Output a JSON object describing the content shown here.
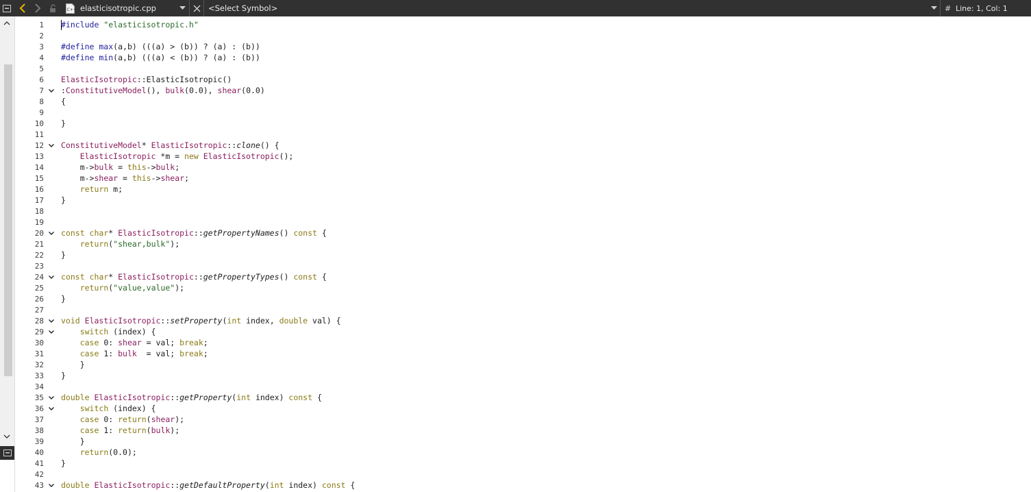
{
  "navbar": {
    "filename": "elasticisotropic.cpp",
    "symbol": "<Select Symbol>",
    "hash": "#",
    "linecol": "Line: 1, Col: 1",
    "icons": [
      "menu-icon",
      "back-icon",
      "forward-icon",
      "lock-icon",
      "cpp-file-icon",
      "chevron-down-icon",
      "close-icon",
      "chevron-down-icon"
    ]
  },
  "colors": {
    "bar_bg": "#313131",
    "back_arrow": "#e6b800",
    "preprocessor": "#1d1d9c",
    "string": "#2a6a2a",
    "class": "#8a1f5e",
    "keyword": "#8a7a16"
  },
  "editor": {
    "lines": [
      {
        "n": "1",
        "fold": false,
        "tokens": [
          [
            "pre",
            "#include "
          ],
          [
            "str",
            "\"elasticisotropic.h\""
          ]
        ]
      },
      {
        "n": "2",
        "fold": false,
        "tokens": []
      },
      {
        "n": "3",
        "fold": false,
        "tokens": [
          [
            "pre",
            "#define max"
          ],
          [
            "p",
            "(a,b) (((a) > (b)) ? (a) : (b))"
          ]
        ]
      },
      {
        "n": "4",
        "fold": false,
        "tokens": [
          [
            "pre",
            "#define min"
          ],
          [
            "p",
            "(a,b) (((a) < (b)) ? (a) : (b))"
          ]
        ]
      },
      {
        "n": "5",
        "fold": false,
        "tokens": []
      },
      {
        "n": "6",
        "fold": false,
        "tokens": [
          [
            "cls",
            "ElasticIsotropic"
          ],
          [
            "p",
            "::ElasticIsotropic()"
          ]
        ]
      },
      {
        "n": "7",
        "fold": true,
        "tokens": [
          [
            "p",
            ":"
          ],
          [
            "cls",
            "ConstitutiveModel"
          ],
          [
            "p",
            "(), "
          ],
          [
            "cls",
            "bulk"
          ],
          [
            "p",
            "(0.0), "
          ],
          [
            "cls",
            "shear"
          ],
          [
            "p",
            "(0.0)"
          ]
        ]
      },
      {
        "n": "8",
        "fold": false,
        "tokens": [
          [
            "p",
            "{"
          ]
        ]
      },
      {
        "n": "9",
        "fold": false,
        "tokens": []
      },
      {
        "n": "10",
        "fold": false,
        "tokens": [
          [
            "p",
            "}"
          ]
        ]
      },
      {
        "n": "11",
        "fold": false,
        "tokens": []
      },
      {
        "n": "12",
        "fold": true,
        "tokens": [
          [
            "cls",
            "ConstitutiveModel"
          ],
          [
            "p",
            "* "
          ],
          [
            "cls",
            "ElasticIsotropic"
          ],
          [
            "p",
            "::"
          ],
          [
            "fn",
            "clone"
          ],
          [
            "p",
            "() {"
          ]
        ]
      },
      {
        "n": "13",
        "fold": false,
        "tokens": [
          [
            "p",
            "    "
          ],
          [
            "cls",
            "ElasticIsotropic"
          ],
          [
            "p",
            " *m = "
          ],
          [
            "kw",
            "new"
          ],
          [
            "p",
            " "
          ],
          [
            "cls",
            "ElasticIsotropic"
          ],
          [
            "p",
            "();"
          ]
        ]
      },
      {
        "n": "14",
        "fold": false,
        "tokens": [
          [
            "p",
            "    m->"
          ],
          [
            "cls",
            "bulk"
          ],
          [
            "p",
            " = "
          ],
          [
            "kw",
            "this"
          ],
          [
            "p",
            "->"
          ],
          [
            "cls",
            "bulk"
          ],
          [
            "p",
            ";"
          ]
        ]
      },
      {
        "n": "15",
        "fold": false,
        "tokens": [
          [
            "p",
            "    m->"
          ],
          [
            "cls",
            "shear"
          ],
          [
            "p",
            " = "
          ],
          [
            "kw",
            "this"
          ],
          [
            "p",
            "->"
          ],
          [
            "cls",
            "shear"
          ],
          [
            "p",
            ";"
          ]
        ]
      },
      {
        "n": "16",
        "fold": false,
        "tokens": [
          [
            "p",
            "    "
          ],
          [
            "kw",
            "return"
          ],
          [
            "p",
            " m;"
          ]
        ]
      },
      {
        "n": "17",
        "fold": false,
        "tokens": [
          [
            "p",
            "}"
          ]
        ]
      },
      {
        "n": "18",
        "fold": false,
        "tokens": []
      },
      {
        "n": "19",
        "fold": false,
        "tokens": []
      },
      {
        "n": "20",
        "fold": true,
        "tokens": [
          [
            "kw",
            "const char"
          ],
          [
            "p",
            "* "
          ],
          [
            "cls",
            "ElasticIsotropic"
          ],
          [
            "p",
            "::"
          ],
          [
            "fn",
            "getPropertyNames"
          ],
          [
            "p",
            "() "
          ],
          [
            "kw",
            "const"
          ],
          [
            "p",
            " {"
          ]
        ]
      },
      {
        "n": "21",
        "fold": false,
        "tokens": [
          [
            "p",
            "    "
          ],
          [
            "kw",
            "return"
          ],
          [
            "p",
            "("
          ],
          [
            "str",
            "\"shear,bulk\""
          ],
          [
            "p",
            ");"
          ]
        ]
      },
      {
        "n": "22",
        "fold": false,
        "tokens": [
          [
            "p",
            "}"
          ]
        ]
      },
      {
        "n": "23",
        "fold": false,
        "tokens": []
      },
      {
        "n": "24",
        "fold": true,
        "tokens": [
          [
            "kw",
            "const char"
          ],
          [
            "p",
            "* "
          ],
          [
            "cls",
            "ElasticIsotropic"
          ],
          [
            "p",
            "::"
          ],
          [
            "fn",
            "getPropertyTypes"
          ],
          [
            "p",
            "() "
          ],
          [
            "kw",
            "const"
          ],
          [
            "p",
            " {"
          ]
        ]
      },
      {
        "n": "25",
        "fold": false,
        "tokens": [
          [
            "p",
            "    "
          ],
          [
            "kw",
            "return"
          ],
          [
            "p",
            "("
          ],
          [
            "str",
            "\"value,value\""
          ],
          [
            "p",
            ");"
          ]
        ]
      },
      {
        "n": "26",
        "fold": false,
        "tokens": [
          [
            "p",
            "}"
          ]
        ]
      },
      {
        "n": "27",
        "fold": false,
        "tokens": []
      },
      {
        "n": "28",
        "fold": true,
        "tokens": [
          [
            "kw",
            "void"
          ],
          [
            "p",
            " "
          ],
          [
            "cls",
            "ElasticIsotropic"
          ],
          [
            "p",
            "::"
          ],
          [
            "fn",
            "setProperty"
          ],
          [
            "p",
            "("
          ],
          [
            "kw",
            "int"
          ],
          [
            "p",
            " index, "
          ],
          [
            "kw",
            "double"
          ],
          [
            "p",
            " val) {"
          ]
        ]
      },
      {
        "n": "29",
        "fold": true,
        "tokens": [
          [
            "p",
            "    "
          ],
          [
            "kw",
            "switch"
          ],
          [
            "p",
            " (index) {"
          ]
        ]
      },
      {
        "n": "30",
        "fold": false,
        "tokens": [
          [
            "p",
            "    "
          ],
          [
            "kw",
            "case"
          ],
          [
            "p",
            " 0: "
          ],
          [
            "cls",
            "shear"
          ],
          [
            "p",
            " = val; "
          ],
          [
            "kw",
            "break"
          ],
          [
            "p",
            ";"
          ]
        ]
      },
      {
        "n": "31",
        "fold": false,
        "tokens": [
          [
            "p",
            "    "
          ],
          [
            "kw",
            "case"
          ],
          [
            "p",
            " 1: "
          ],
          [
            "cls",
            "bulk"
          ],
          [
            "p",
            "  = val; "
          ],
          [
            "kw",
            "break"
          ],
          [
            "p",
            ";"
          ]
        ]
      },
      {
        "n": "32",
        "fold": false,
        "tokens": [
          [
            "p",
            "    }"
          ]
        ]
      },
      {
        "n": "33",
        "fold": false,
        "tokens": [
          [
            "p",
            "}"
          ]
        ]
      },
      {
        "n": "34",
        "fold": false,
        "tokens": []
      },
      {
        "n": "35",
        "fold": true,
        "tokens": [
          [
            "kw",
            "double"
          ],
          [
            "p",
            " "
          ],
          [
            "cls",
            "ElasticIsotropic"
          ],
          [
            "p",
            "::"
          ],
          [
            "fn",
            "getProperty"
          ],
          [
            "p",
            "("
          ],
          [
            "kw",
            "int"
          ],
          [
            "p",
            " index) "
          ],
          [
            "kw",
            "const"
          ],
          [
            "p",
            " {"
          ]
        ]
      },
      {
        "n": "36",
        "fold": true,
        "tokens": [
          [
            "p",
            "    "
          ],
          [
            "kw",
            "switch"
          ],
          [
            "p",
            " (index) {"
          ]
        ]
      },
      {
        "n": "37",
        "fold": false,
        "tokens": [
          [
            "p",
            "    "
          ],
          [
            "kw",
            "case"
          ],
          [
            "p",
            " 0: "
          ],
          [
            "kw",
            "return"
          ],
          [
            "p",
            "("
          ],
          [
            "cls",
            "shear"
          ],
          [
            "p",
            ");"
          ]
        ]
      },
      {
        "n": "38",
        "fold": false,
        "tokens": [
          [
            "p",
            "    "
          ],
          [
            "kw",
            "case"
          ],
          [
            "p",
            " 1: "
          ],
          [
            "kw",
            "return"
          ],
          [
            "p",
            "("
          ],
          [
            "cls",
            "bulk"
          ],
          [
            "p",
            ");"
          ]
        ]
      },
      {
        "n": "39",
        "fold": false,
        "tokens": [
          [
            "p",
            "    }"
          ]
        ]
      },
      {
        "n": "40",
        "fold": false,
        "tokens": [
          [
            "p",
            "    "
          ],
          [
            "kw",
            "return"
          ],
          [
            "p",
            "(0.0);"
          ]
        ]
      },
      {
        "n": "41",
        "fold": false,
        "tokens": [
          [
            "p",
            "}"
          ]
        ]
      },
      {
        "n": "42",
        "fold": false,
        "tokens": []
      },
      {
        "n": "43",
        "fold": true,
        "tokens": [
          [
            "kw",
            "double"
          ],
          [
            "p",
            " "
          ],
          [
            "cls",
            "ElasticIsotropic"
          ],
          [
            "p",
            "::"
          ],
          [
            "fn",
            "getDefaultProperty"
          ],
          [
            "p",
            "("
          ],
          [
            "kw",
            "int"
          ],
          [
            "p",
            " index) "
          ],
          [
            "kw",
            "const"
          ],
          [
            "p",
            " {"
          ]
        ]
      }
    ]
  }
}
